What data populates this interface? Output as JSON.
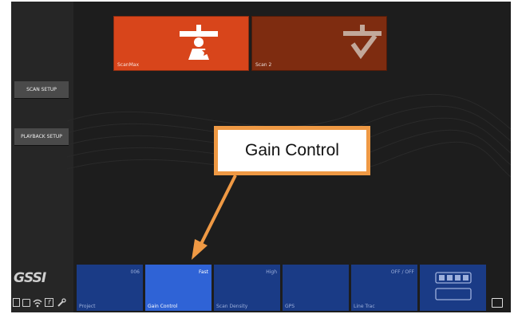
{
  "top_tiles": [
    {
      "label": "ScanMax",
      "icon": "person-scanner-icon",
      "color": "#d8451b"
    },
    {
      "label": "Scan 2",
      "icon": "scan-tool-icon",
      "color": "#7e2c10"
    }
  ],
  "side_buttons": [
    "SCAN SETUP",
    "PLAYBACK SETUP"
  ],
  "brand": {
    "logo_text": "GSSI"
  },
  "bottom_tiles": [
    {
      "value": "006",
      "name": "Project"
    },
    {
      "value": "Fast",
      "name": "Gain Control"
    },
    {
      "value": "High",
      "name": "Scan Density"
    },
    {
      "value": "",
      "name": "GPS"
    },
    {
      "value": "OFF / OFF",
      "name": "Line Trac"
    }
  ],
  "callout": {
    "text": "Gain Control"
  },
  "colors": {
    "accent_orange": "#d8451b",
    "tile_blue": "#1a3b86",
    "active_blue": "#2f63d6",
    "callout_border": "#ef9944"
  }
}
